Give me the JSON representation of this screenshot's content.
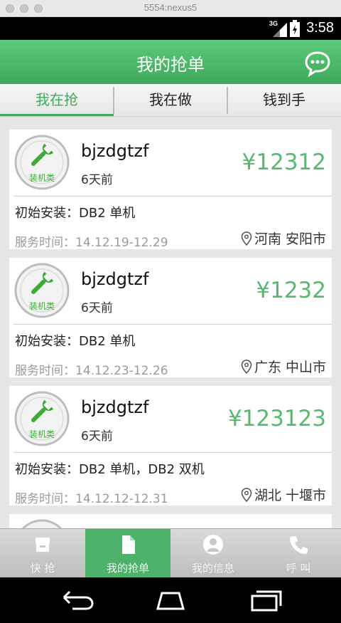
{
  "emulator": {
    "title": "5554:nexus5"
  },
  "status_bar": {
    "signal_type": "3G",
    "time": "3:58"
  },
  "header": {
    "title": "我的抢单"
  },
  "tabs": [
    {
      "label": "我在抢",
      "active": true
    },
    {
      "label": "我在做",
      "active": false
    },
    {
      "label": "钱到手",
      "active": false
    }
  ],
  "orders": [
    {
      "category": "装机类",
      "user": "bjzdgtzf",
      "time_ago": "6天前",
      "price": "¥12312",
      "desc": "初始安装：DB2 单机",
      "service_time": "服务时间：14.12.19-12.29",
      "location": "河南 安阳市"
    },
    {
      "category": "装机类",
      "user": "bjzdgtzf",
      "time_ago": "6天前",
      "price": "¥1232",
      "desc": "初始安装：DB2 单机",
      "service_time": "服务时间：14.12.23-12.26",
      "location": "广东 中山市"
    },
    {
      "category": "装机类",
      "user": "bjzdgtzf",
      "time_ago": "6天前",
      "price": "¥123123",
      "desc": "初始安装：DB2 单机，DB2 双机",
      "service_time": "服务时间：14.12.12-12.31",
      "location": "湖北 十堰市"
    }
  ],
  "bottom_nav": [
    {
      "label": "快 抢",
      "icon": "box-icon",
      "active": false
    },
    {
      "label": "我的抢单",
      "icon": "document-icon",
      "active": true
    },
    {
      "label": "我的信息",
      "icon": "user-icon",
      "active": false
    },
    {
      "label": "呼 叫",
      "icon": "phone-icon",
      "active": false
    }
  ],
  "colors": {
    "brand_green": "#4db26a",
    "price_green": "#57b96f"
  }
}
